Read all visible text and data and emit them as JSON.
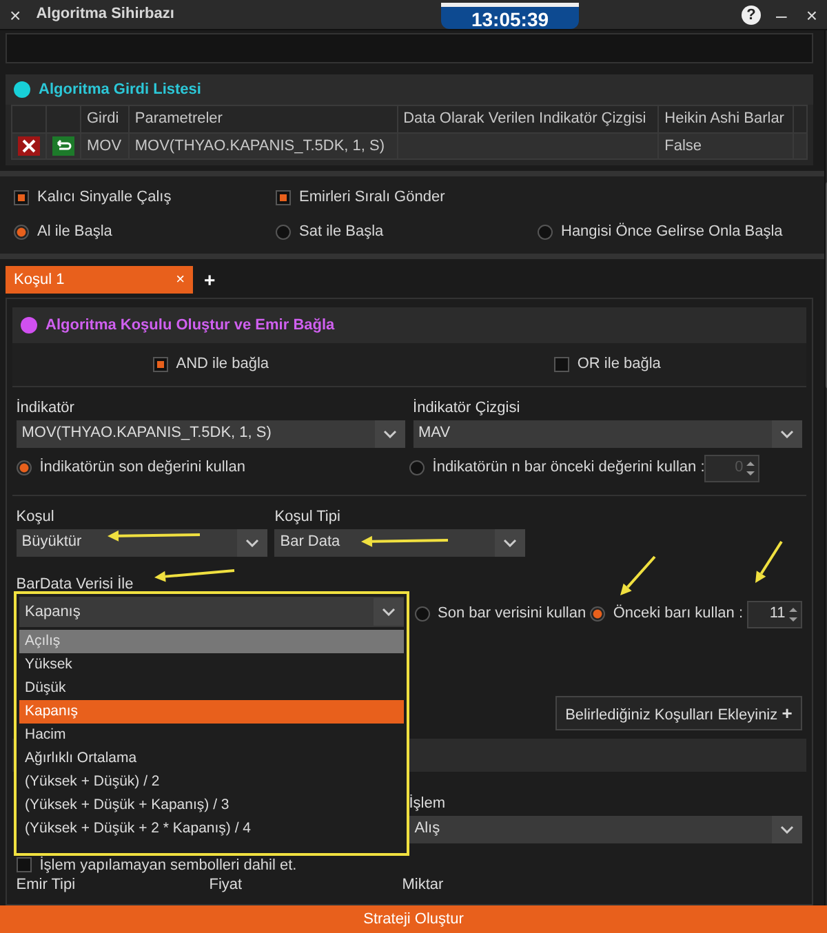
{
  "window": {
    "title": "Algoritma Sihirbazı",
    "clock": "13:05:39",
    "close_left": "×",
    "help": "?",
    "minimize": "–",
    "close": "×"
  },
  "input_list": {
    "title": "Algoritma Girdi Listesi",
    "columns": [
      "Girdi",
      "Parametreler",
      "Data Olarak Verilen Indikatör Çizgisi",
      "Heikin Ashi Barlar"
    ],
    "rows": [
      {
        "input": "MOV",
        "parameters": "MOV(THYAO.KAPANIS_T.5DK, 1, S)",
        "heikin_ashi": "False"
      }
    ]
  },
  "options": {
    "checkboxes": [
      {
        "label": "Kalıcı Sinyalle Çalış",
        "checked": true
      },
      {
        "label": "Emirleri Sıralı Gönder",
        "checked": true
      }
    ],
    "radios": [
      {
        "label": "Al ile Başla",
        "selected": true
      },
      {
        "label": "Sat ile Başla",
        "selected": false
      },
      {
        "label": "Hangisi Önce Gelirse Onla Başla",
        "selected": false
      }
    ]
  },
  "tabs": [
    {
      "label": "Koşul 1",
      "close": "×",
      "selected": true
    }
  ],
  "add_tab": "+",
  "condition": {
    "title": "Algoritma Koşulu Oluştur ve Emir Bağla",
    "connectors": [
      {
        "label": "AND ile bağla",
        "checked": true
      },
      {
        "label": "OR ile bağla",
        "checked": false
      }
    ],
    "indicator": {
      "label": "İndikatör",
      "value": "MOV(THYAO.KAPANIS_T.5DK, 1, S)"
    },
    "indicator_line": {
      "label": "İndikatör Çizgisi",
      "value": "MAV"
    },
    "value_modes": [
      {
        "label": "İndikatörün son değerini kullan",
        "selected": true
      },
      {
        "label": "İndikatörün n bar önceki değerini kullan :",
        "selected": false
      }
    ],
    "n_bar": {
      "value": "0",
      "disabled": true
    },
    "kosul": {
      "label": "Koşul",
      "value": "Büyüktür"
    },
    "kosul_tipi": {
      "label": "Koşul Tipi",
      "value": "Bar Data"
    },
    "bardata": {
      "label": "BarData Verisi İle",
      "value": "Kapanış"
    },
    "bar_modes": [
      {
        "label": "Son bar verisini kullan",
        "selected": false
      },
      {
        "label": "Önceki barı kullan :",
        "selected": true
      }
    ],
    "prev_bar": {
      "value": "11",
      "disabled": false
    },
    "add_button": "Belirlediğiniz Koşulları Ekleyiniz",
    "add_icon": "+"
  },
  "dropdown_options": [
    {
      "label": "Açılış",
      "selected": false,
      "hovered": true
    },
    {
      "label": "Yüksek",
      "selected": false,
      "hovered": false
    },
    {
      "label": "Düşük",
      "selected": false,
      "hovered": false
    },
    {
      "label": "Kapanış",
      "selected": true,
      "hovered": false
    },
    {
      "label": "Hacim",
      "selected": false,
      "hovered": false
    },
    {
      "label": "Ağırlıklı Ortalama",
      "selected": false,
      "hovered": false
    },
    {
      "label": "(Yüksek + Düşük) / 2",
      "selected": false,
      "hovered": false
    },
    {
      "label": "(Yüksek + Düşük + Kapanış) / 3",
      "selected": false,
      "hovered": false
    },
    {
      "label": "(Yüksek + Düşük + 2 * Kapanış) / 4",
      "selected": false,
      "hovered": false
    }
  ],
  "order": {
    "islem": {
      "label": "İşlem",
      "value": "Alış"
    },
    "include_untraded": {
      "label": "İşlem yapılamayan sembolleri dahil et.",
      "checked": false
    },
    "column_labels": [
      "Emir Tipi",
      "Fiyat",
      "Miktar"
    ]
  },
  "footer_button": "Strateji Oluştur"
}
